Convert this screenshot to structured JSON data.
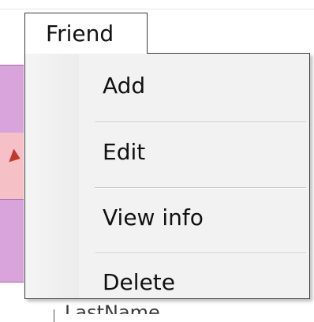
{
  "menu": {
    "title": "Friend",
    "items": [
      {
        "label": "Add"
      },
      {
        "label": "Edit"
      },
      {
        "label": "View info"
      },
      {
        "label": "Delete"
      }
    ]
  },
  "background": {
    "partial_label": "LastName"
  },
  "colors": {
    "band_purple": "#d9a3dc",
    "band_pink": "#f5c0c6",
    "arrow_red": "#c0392b",
    "menu_background": "#f2f2f2",
    "border": "#3c3c3c"
  }
}
